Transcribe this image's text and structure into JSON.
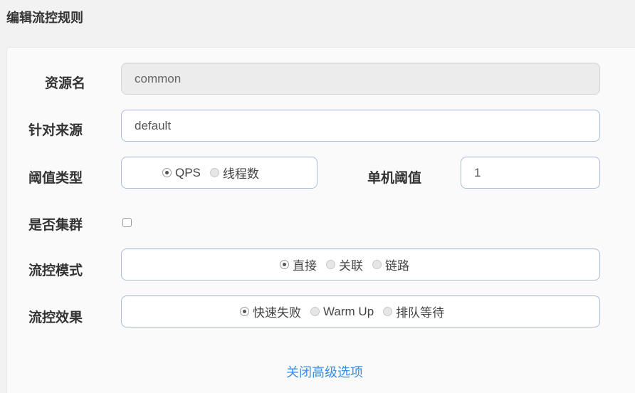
{
  "dialog": {
    "title": "编辑流控规则"
  },
  "form": {
    "resource": {
      "label": "资源名",
      "value": "common"
    },
    "limit_app": {
      "label": "针对来源",
      "value": "default"
    },
    "grade": {
      "label": "阈值类型",
      "options": [
        "QPS",
        "线程数"
      ],
      "selected": "QPS"
    },
    "count": {
      "label": "单机阈值",
      "value": "1"
    },
    "cluster": {
      "label": "是否集群",
      "checked": false
    },
    "strategy": {
      "label": "流控模式",
      "options": [
        "直接",
        "关联",
        "链路"
      ],
      "selected": "直接"
    },
    "control_behavior": {
      "label": "流控效果",
      "options": [
        "快速失败",
        "Warm Up",
        "排队等待"
      ],
      "selected": "快速失败"
    },
    "advanced_toggle": "关闭高级选项"
  },
  "colors": {
    "accent_link": "#3a8ee6",
    "input_border": "#a9bfd6",
    "disabled_bg": "#ececec"
  }
}
